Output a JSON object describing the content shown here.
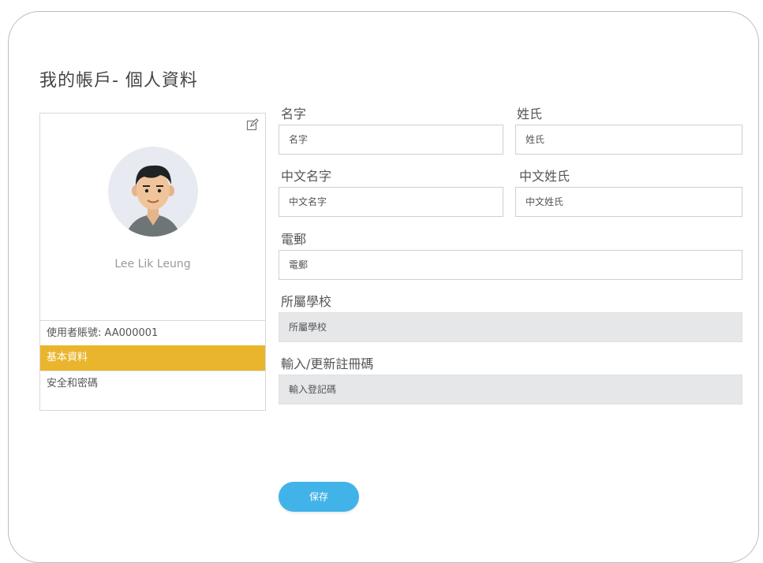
{
  "page": {
    "title": "我的帳戶- 個人資料"
  },
  "profile": {
    "name": "Lee Lik Leung",
    "account_id": "使用者賬號: AA000001",
    "menu": {
      "basic_info": "基本資料",
      "security": "安全和密碼"
    }
  },
  "form": {
    "first_name": {
      "label": "名字",
      "placeholder": "名字"
    },
    "last_name": {
      "label": "姓氏",
      "placeholder": "姓氏"
    },
    "chinese_first_name": {
      "label": "中文名字",
      "placeholder": "中文名字"
    },
    "chinese_last_name": {
      "label": "中文姓氏",
      "placeholder": "中文姓氏"
    },
    "email": {
      "label": "電郵",
      "placeholder": "電郵"
    },
    "school": {
      "label": "所屬學校",
      "value": "所屬學校"
    },
    "registration_code": {
      "label": "輸入/更新註冊碼",
      "placeholder": "輸入登記碼"
    }
  },
  "actions": {
    "save": "保存"
  },
  "colors": {
    "accent_menu": "#e9b52c",
    "save_button": "#42b3e8"
  }
}
